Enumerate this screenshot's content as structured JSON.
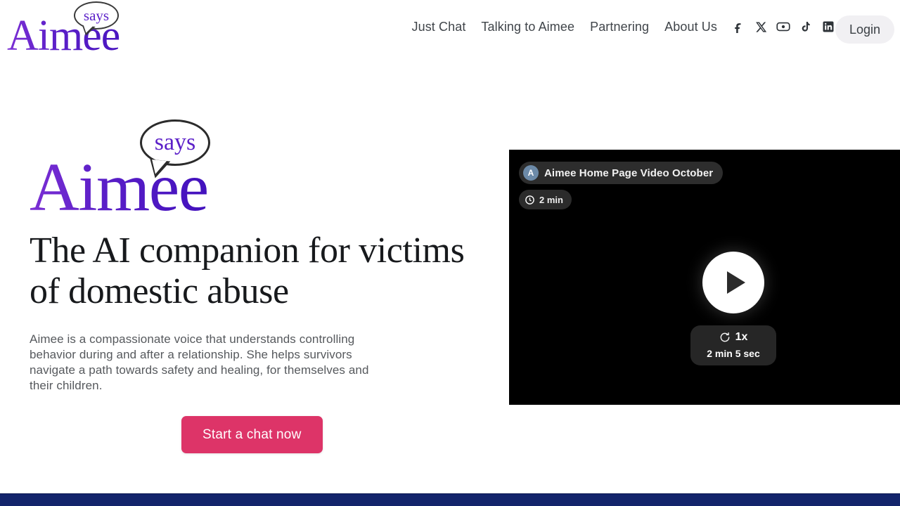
{
  "brand": {
    "name": "Aimee",
    "bubble_word": "says",
    "purple": "#5b1fc8",
    "accent_pink": "#dd3468",
    "footer_navy": "#13246b"
  },
  "header": {
    "nav": [
      {
        "label": "Just Chat"
      },
      {
        "label": "Talking to Aimee"
      },
      {
        "label": "Partnering"
      },
      {
        "label": "About Us"
      }
    ],
    "socials": [
      {
        "name": "facebook-icon",
        "label": "Facebook"
      },
      {
        "name": "x-twitter-icon",
        "label": "X"
      },
      {
        "name": "youtube-icon",
        "label": "YouTube"
      },
      {
        "name": "tiktok-icon",
        "label": "TikTok"
      },
      {
        "name": "linkedin-icon",
        "label": "LinkedIn"
      }
    ],
    "login_label": "Login"
  },
  "hero": {
    "logo_word": "Aimee",
    "logo_bubble": "says",
    "headline": "The AI companion for victims of domestic abuse",
    "paragraph": "Aimee is a compassionate voice that understands controlling behavior during and after a relationship. She helps survivors navigate a path towards safety and healing, for themselves and their children.",
    "cta_label": "Start a chat now"
  },
  "video": {
    "avatar_initial": "A",
    "title": "Aimee Home Page Video October",
    "duration_chip": "2 min",
    "speed": "1x",
    "elapsed": "2 min 5 sec",
    "play_label": "Play"
  }
}
